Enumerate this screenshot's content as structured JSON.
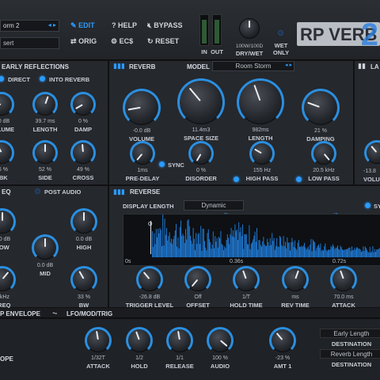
{
  "preset": {
    "name": "orm 2",
    "sub": "sert"
  },
  "toolbar": {
    "edit": "EDIT",
    "help": "HELP",
    "bypass": "BYPASS",
    "orig": "ORIG",
    "ecs": "EC$",
    "reset": "RESET",
    "in": "IN",
    "out": "OUT",
    "drywet_value": "100W/100D",
    "drywet_label": "DRY/WET",
    "wetonly_1": "WET",
    "wetonly_2": "ONLY",
    "logo": "RP VERB",
    "logo_num": "2"
  },
  "early": {
    "title": "EARLY REFLECTIONS",
    "direct": "DIRECT",
    "into_reverb": "INTO REVERB",
    "knobs": [
      {
        "value": "0.0 dB",
        "label": "VOLUME"
      },
      {
        "value": "39.7 ms",
        "label": "LENGTH"
      },
      {
        "value": "0 %",
        "label": "DAMP"
      },
      {
        "value": "36 %",
        "label": "FBK"
      },
      {
        "value": "52 %",
        "label": "SIDE"
      },
      {
        "value": "49 %",
        "label": "CROSS"
      }
    ]
  },
  "reverb": {
    "title": "REVERB",
    "model_label": "MODEL",
    "model_value": "Room Storm",
    "knobs": [
      {
        "value": "-0.0 dB",
        "label": "VOLUME"
      },
      {
        "value": "11.4m3",
        "label": "SPACE SIZE"
      },
      {
        "value": "982ms",
        "label": "LENGTH"
      },
      {
        "value": "21 %",
        "label": "DAMPING"
      }
    ],
    "small": [
      {
        "value": "1ms",
        "label": "PRE-DELAY"
      },
      {
        "value": "0 %",
        "label": "DISORDER"
      },
      {
        "value": "155 Hz",
        "label": "HIGH PASS"
      },
      {
        "value": "20.5 kHz",
        "label": "LOW PASS"
      }
    ],
    "sync": "SYNC"
  },
  "late": {
    "title": "LA",
    "vol_value": "-13.8",
    "vol_label": "VOLU"
  },
  "eq": {
    "title": "EQ",
    "post_audio": "POST AUDIO",
    "knobs": [
      {
        "value": "0.0 dB",
        "label": "LOW"
      },
      {
        "value": "0.0 dB",
        "label": "HIGH"
      },
      {
        "value": "0.0 dB",
        "label": "MID"
      },
      {
        "value": "7 kHz",
        "label": "FREQ"
      },
      {
        "value": "33 %",
        "label": "BW"
      }
    ]
  },
  "reverse": {
    "title": "REVERSE",
    "display_length": "DISPLAY LENGTH",
    "display_value": "Dynamic",
    "sync": "SY",
    "time_marks": [
      "0s",
      "0.36s",
      "0.72s"
    ],
    "knobs": [
      {
        "value": "-26.8 dB",
        "label": "TRIGGER LEVEL"
      },
      {
        "value": "Off",
        "label": "OFFSET"
      },
      {
        "value": "1/T",
        "label": "HOLD TIME"
      },
      {
        "value": "ms",
        "label": "REV TIME"
      },
      {
        "value": "70.0 ms",
        "label": "ATTACK"
      }
    ]
  },
  "bottom": {
    "tab1": "P ENVELOPE",
    "tab2": "LFO/MOD/TRIG",
    "ope": "OPE",
    "knobs": [
      {
        "value": "1/32T",
        "label": "ATTACK"
      },
      {
        "value": "1/2",
        "label": "HOLD"
      },
      {
        "value": "1/1",
        "label": "RELEASE"
      },
      {
        "value": "100 %",
        "label": "AUDIO"
      },
      {
        "value": "-23 %",
        "label": "AMT 1"
      }
    ],
    "dest": [
      {
        "name": "Early Length",
        "label": "DESTINATION"
      },
      {
        "name": "Reverb Length",
        "label": "DESTINATION"
      }
    ]
  },
  "colors": {
    "accent": "#2a9bff",
    "bg": "#1c1e22"
  }
}
